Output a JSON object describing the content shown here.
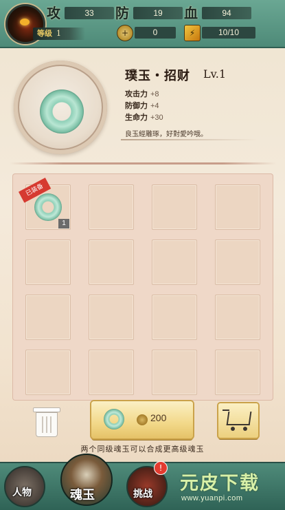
{
  "header": {
    "level_label": "等级",
    "level_value": "1",
    "attack": {
      "char": "攻",
      "value": "33"
    },
    "defense": {
      "char": "防",
      "value": "19"
    },
    "hp": {
      "char": "血",
      "value": "94"
    },
    "coins": "0",
    "energy": "10/10",
    "coin_icon_glyph": "+"
  },
  "item": {
    "name": "璞玉・招财",
    "level": "Lv.1",
    "attributes": [
      {
        "label": "攻击力",
        "value": "+8"
      },
      {
        "label": "防御力",
        "value": "+4"
      },
      {
        "label": "生命力",
        "value": "+30"
      }
    ],
    "description": "良玉經雕琢，好對愛吟哦。"
  },
  "grid": {
    "equipped_label": "已装备",
    "first_slot_qty": "1",
    "rows": 4,
    "cols": 4
  },
  "actions": {
    "synth_cost": "200",
    "hint": "两个同级魂玉可以合成更高级魂玉"
  },
  "nav": {
    "items": [
      {
        "label": "人物",
        "icon": "chain-icon"
      },
      {
        "label": "魂玉",
        "icon": "spirit-icon"
      },
      {
        "label": "挑战",
        "icon": "demon-icon"
      }
    ],
    "badge": "!"
  },
  "watermark": {
    "title": "元皮下载",
    "url": "www.yuanpi.com"
  },
  "colors": {
    "header": "#4e8a78",
    "jade": "#8fd0b8",
    "ribbon": "#d63a31",
    "button": "#f2d889"
  }
}
